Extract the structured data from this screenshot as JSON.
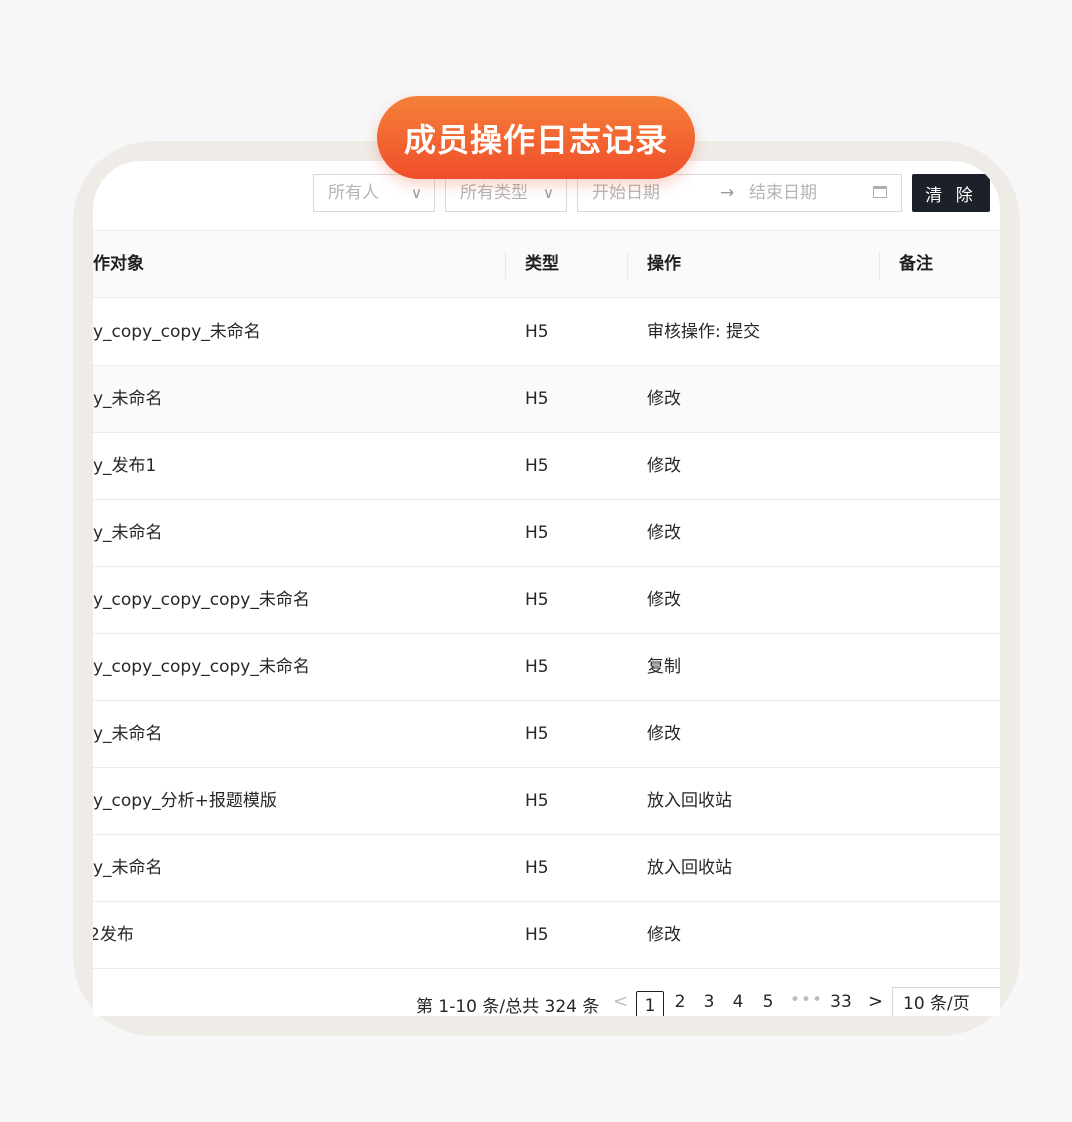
{
  "title": "成员操作日志记录",
  "filters": {
    "member_select": "所有人",
    "type_select": "所有类型",
    "start_date_placeholder": "开始日期",
    "end_date_placeholder": "结束日期",
    "arrow": "→",
    "clear_label": "清 除"
  },
  "table": {
    "headers": [
      "作对象",
      "类型",
      "操作",
      "备注"
    ],
    "rows": [
      {
        "object": "y_copy_copy_未命名",
        "type": "H5",
        "action": "审核操作: 提交",
        "note": ""
      },
      {
        "object": "y_未命名",
        "type": "H5",
        "action": "修改",
        "note": ""
      },
      {
        "object": "y_发布1",
        "type": "H5",
        "action": "修改",
        "note": ""
      },
      {
        "object": "y_未命名",
        "type": "H5",
        "action": "修改",
        "note": ""
      },
      {
        "object": "y_copy_copy_copy_未命名",
        "type": "H5",
        "action": "修改",
        "note": ""
      },
      {
        "object": "y_copy_copy_copy_未命名",
        "type": "H5",
        "action": "复制",
        "note": ""
      },
      {
        "object": "y_未命名",
        "type": "H5",
        "action": "修改",
        "note": ""
      },
      {
        "object": "y_copy_分析+报题模版",
        "type": "H5",
        "action": "放入回收站",
        "note": ""
      },
      {
        "object": "y_未命名",
        "type": "H5",
        "action": "放入回收站",
        "note": ""
      },
      {
        "object": "2发布",
        "type": "H5",
        "action": "修改",
        "note": ""
      }
    ]
  },
  "pagination": {
    "summary": "第 1-10 条/总共 324 条",
    "prev": "<",
    "next": ">",
    "current": "1",
    "pages": [
      "2",
      "3",
      "4",
      "5"
    ],
    "ellipsis": "•••",
    "last": "33",
    "page_size": "10 条/页"
  }
}
